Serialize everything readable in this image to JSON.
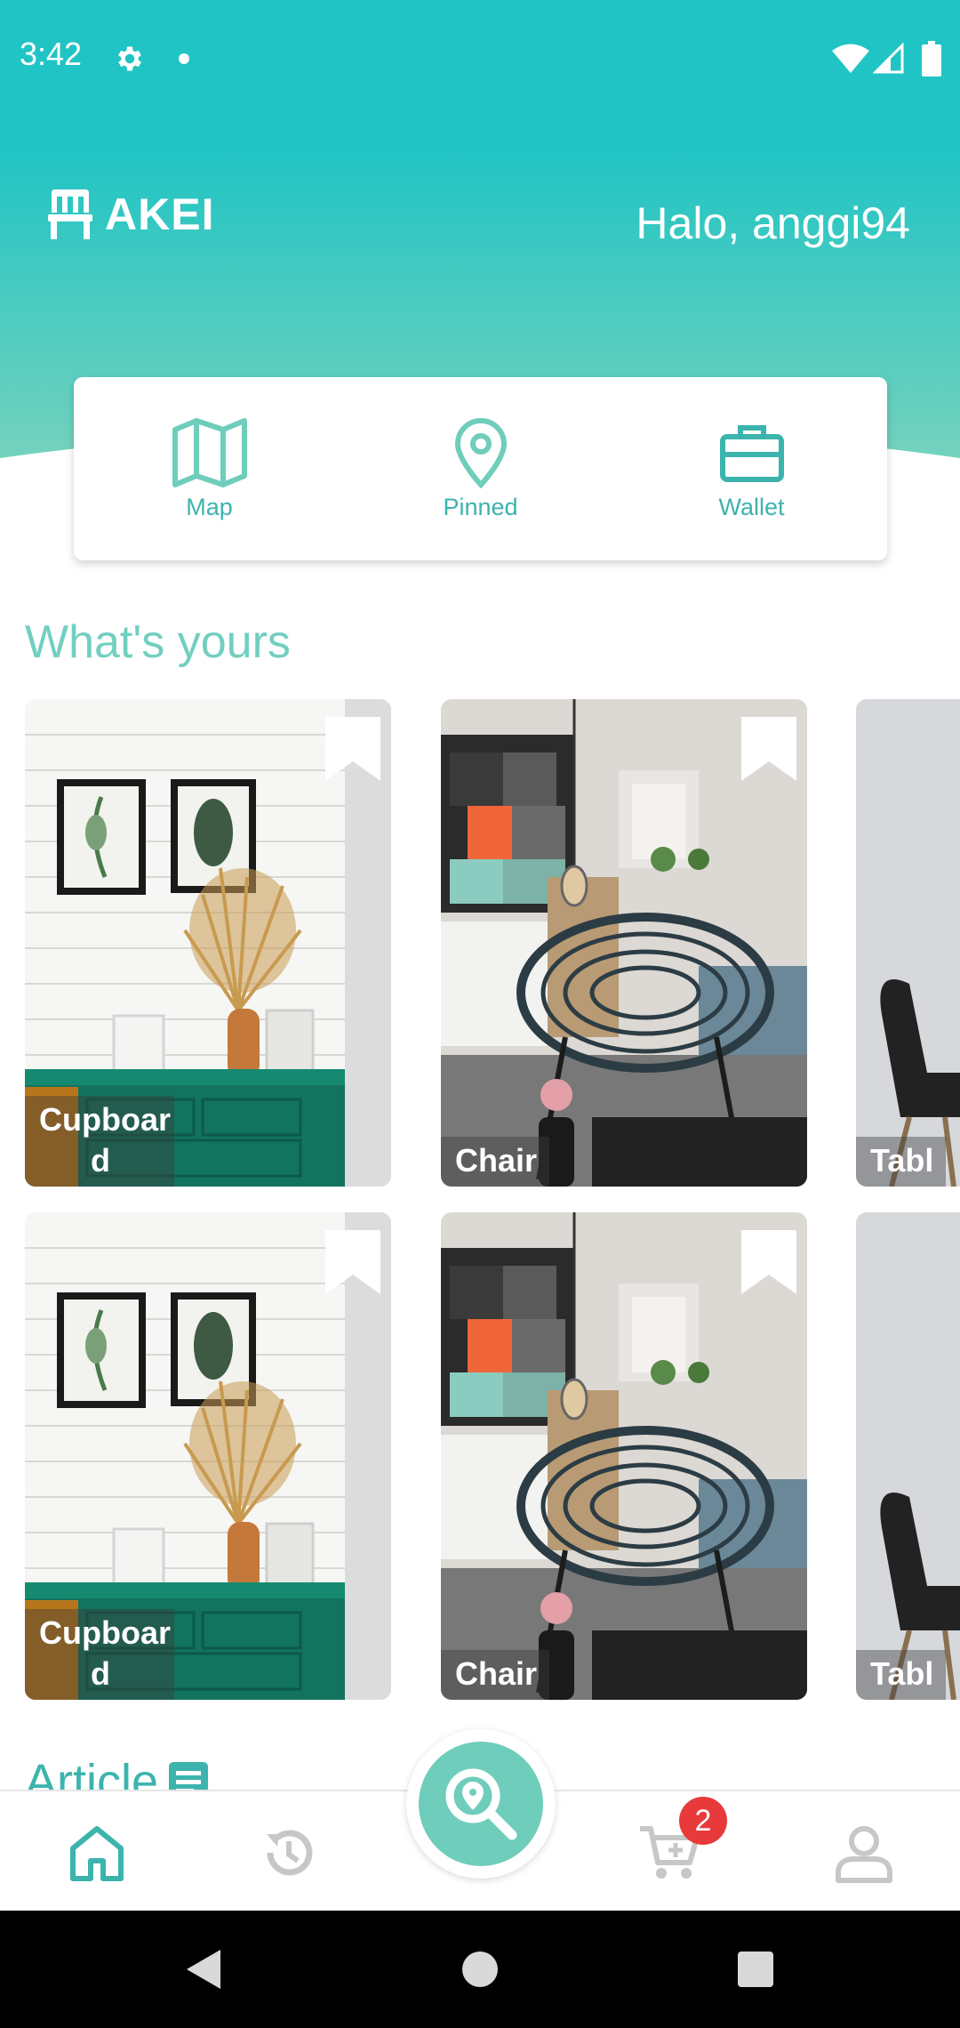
{
  "status_bar": {
    "time": "3:42"
  },
  "header": {
    "brand": "AKEI",
    "greeting": "Halo, anggi94"
  },
  "menu": [
    {
      "label": "Map",
      "icon": "map-icon"
    },
    {
      "label": "Pinned",
      "icon": "pin-icon"
    },
    {
      "label": "Wallet",
      "icon": "briefcase-icon"
    }
  ],
  "section_title": "What's yours",
  "cards_row1": [
    {
      "label": "Cupboar\nd",
      "image": "cupboard-photo"
    },
    {
      "label": "Chair",
      "image": "chair-photo"
    },
    {
      "label": "Tabl",
      "image": "table-photo"
    }
  ],
  "cards_row2": [
    {
      "label": "Cupboar\nd",
      "image": "cupboard-photo"
    },
    {
      "label": "Chair",
      "image": "chair-photo"
    },
    {
      "label": "Tabl",
      "image": "table-photo"
    }
  ],
  "article_title": "Article",
  "bottom_nav": {
    "items": [
      "home-icon",
      "history-icon",
      "search-location-icon",
      "cart-icon",
      "profile-icon"
    ],
    "cart_badge": "2"
  },
  "colors": {
    "primary": "#21c4c4",
    "accent": "#3cb4ad",
    "title": "#72cfc0",
    "badge": "#e83a3a"
  }
}
